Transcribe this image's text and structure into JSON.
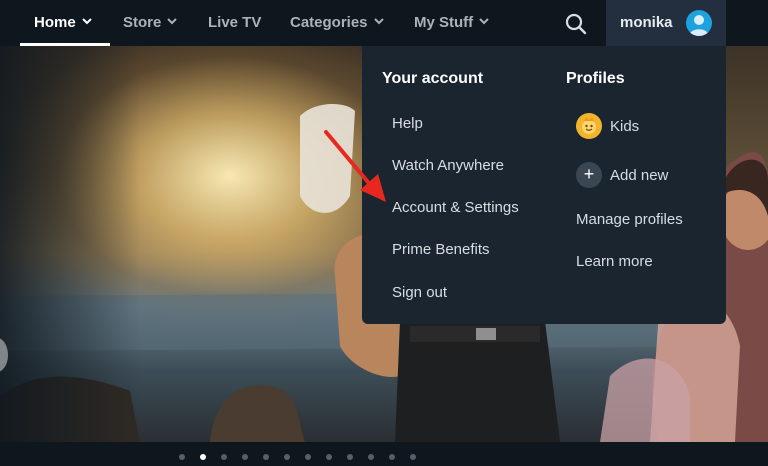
{
  "nav": {
    "items": [
      {
        "label": "Home",
        "has_chevron": true,
        "active": true
      },
      {
        "label": "Store",
        "has_chevron": true,
        "active": false
      },
      {
        "label": "Live TV",
        "has_chevron": false,
        "active": false
      },
      {
        "label": "Categories",
        "has_chevron": true,
        "active": false
      },
      {
        "label": "My Stuff",
        "has_chevron": true,
        "active": false
      }
    ],
    "search_icon": "search-icon",
    "profile_name": "monika",
    "avatar_icon": "avatar-icon"
  },
  "menu": {
    "account_heading": "Your account",
    "account_links": [
      "Help",
      "Watch Anywhere",
      "Account & Settings",
      "Prime Benefits",
      "Sign out"
    ],
    "profiles_heading": "Profiles",
    "profiles": [
      {
        "label": "Kids",
        "icon": "kids-profile-icon"
      },
      {
        "label": "Add new",
        "icon": "plus-icon"
      }
    ],
    "profile_links": [
      "Manage profiles",
      "Learn more"
    ]
  },
  "annotation": {
    "type": "arrow",
    "color": "#e8281f",
    "points_to": "Account & Settings"
  },
  "carousel": {
    "dot_count": 12,
    "active_index": 1
  },
  "colors": {
    "nav_bg": "#0f171e",
    "menu_bg": "#1b2530",
    "profile_tab_bg": "#232f3e",
    "accent_avatar": "#1fa0df",
    "kids_icon": "#f3b42d"
  }
}
